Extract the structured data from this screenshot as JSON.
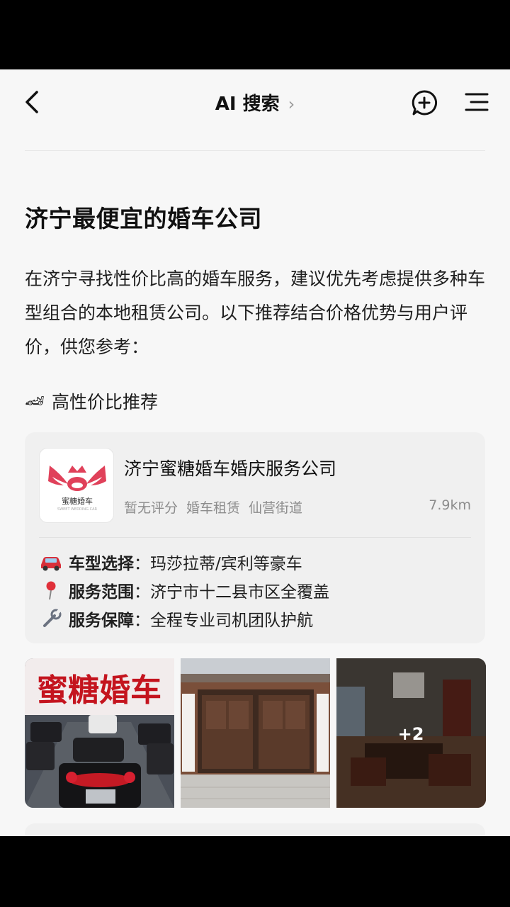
{
  "nav": {
    "title": "AI 搜索",
    "title_chevron": "›"
  },
  "query": {
    "heading": "济宁最便宜的婚车公司"
  },
  "intro": {
    "text": "在济宁寻找性价比高的婚车服务，建议优先考虑提供多种车型组合的本地租赁公司。以下推荐结合价格优势与用户评价，供您参考："
  },
  "recommend": {
    "icon": "🏎",
    "title": "高性价比推荐"
  },
  "card": {
    "logo_text": "蜜糖婚车",
    "logo_sub": "SWEET WEDDING CAR",
    "company": "济宁蜜糖婚车婚庆服务公司",
    "rating": "暂无评分",
    "category": "婚车租赁",
    "area": "仙营街道",
    "distance": "7.9km",
    "features": [
      {
        "icon": "car-icon",
        "key": "车型选择",
        "colon": "：",
        "value": "玛莎拉蒂/宾利等豪车"
      },
      {
        "icon": "pin-icon",
        "key": "服务范围",
        "colon": "：",
        "value": "济宁市十二县市区全覆盖"
      },
      {
        "icon": "wrench-icon",
        "key": "服务保障",
        "colon": "：",
        "value": "全程专业司机团队护航"
      }
    ]
  },
  "photos": {
    "banner_text": "蜜糖婚车",
    "more_count": "+2"
  },
  "colors": {
    "background": "#f7f7f7",
    "card": "#f0f0f0",
    "muted": "#8c8c8c",
    "logo_red": "#e0415a"
  }
}
